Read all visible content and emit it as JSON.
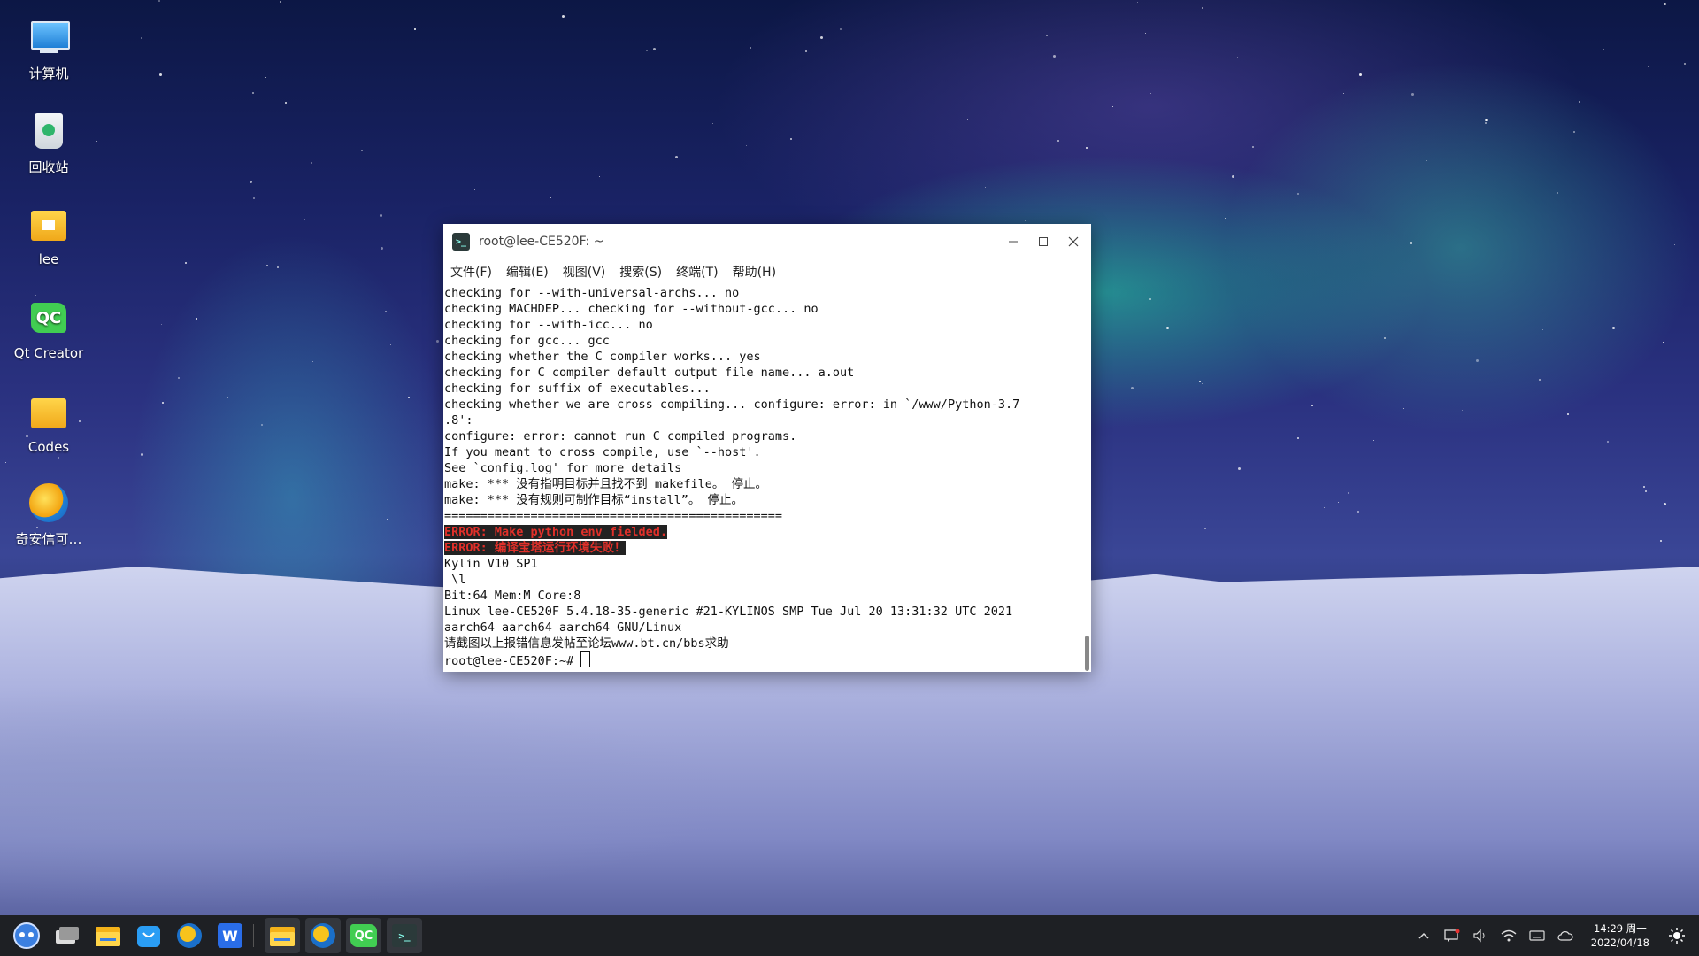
{
  "desktop_icons": [
    {
      "label": "计算机",
      "icon": "computer-icon"
    },
    {
      "label": "回收站",
      "icon": "trash-icon"
    },
    {
      "label": "lee",
      "icon": "home-folder-icon"
    },
    {
      "label": "Qt Creator",
      "icon": "qt-creator-icon"
    },
    {
      "label": "Codes",
      "icon": "folder-icon"
    },
    {
      "label": "奇安信可…",
      "icon": "browser-icon"
    }
  ],
  "terminal": {
    "title": "root@lee-CE520F: ~",
    "app_icon_text": ">_",
    "menu": [
      "文件(F)",
      "编辑(E)",
      "视图(V)",
      "搜索(S)",
      "终端(T)",
      "帮助(H)"
    ],
    "lines": [
      "checking for --with-universal-archs... no",
      "checking MACHDEP... checking for --without-gcc... no",
      "checking for --with-icc... no",
      "checking for gcc... gcc",
      "checking whether the C compiler works... yes",
      "checking for C compiler default output file name... a.out",
      "checking for suffix of executables...",
      "checking whether we are cross compiling... configure: error: in `/www/Python-3.7",
      ".8':",
      "configure: error: cannot run C compiled programs.",
      "If you meant to cross compile, use `--host'.",
      "See `config.log' for more details",
      "make: *** 没有指明目标并且找不到 makefile。 停止。",
      "make: *** 没有规则可制作目标“install”。 停止。",
      "==============================================="
    ],
    "errors": [
      "ERROR: Make python env fielded.",
      "ERROR: 编译宝塔运行环境失败！"
    ],
    "tail_lines": [
      "Kylin V10 SP1",
      " \\l",
      "Bit:64 Mem:M Core:8",
      "Linux lee-CE520F 5.4.18-35-generic #21-KYLINOS SMP Tue Jul 20 13:31:32 UTC 2021",
      "aarch64 aarch64 aarch64 GNU/Linux",
      "请截图以上报错信息发帖至论坛www.bt.cn/bbs求助"
    ],
    "prompt": "root@lee-CE520F:~# "
  },
  "taskbar": {
    "apps": [
      "start-menu-icon",
      "multitask-view-icon",
      "file-manager-icon",
      "software-store-icon",
      "browser-icon",
      "wps-icon"
    ],
    "running": [
      "file-manager-icon",
      "browser-icon",
      "qt-creator-icon",
      "terminal-icon"
    ],
    "clock_time": "14:29 周一",
    "clock_date": "2022/04/18",
    "qt_text": "QC",
    "wps_text": "W",
    "terminal_text": ">_"
  }
}
